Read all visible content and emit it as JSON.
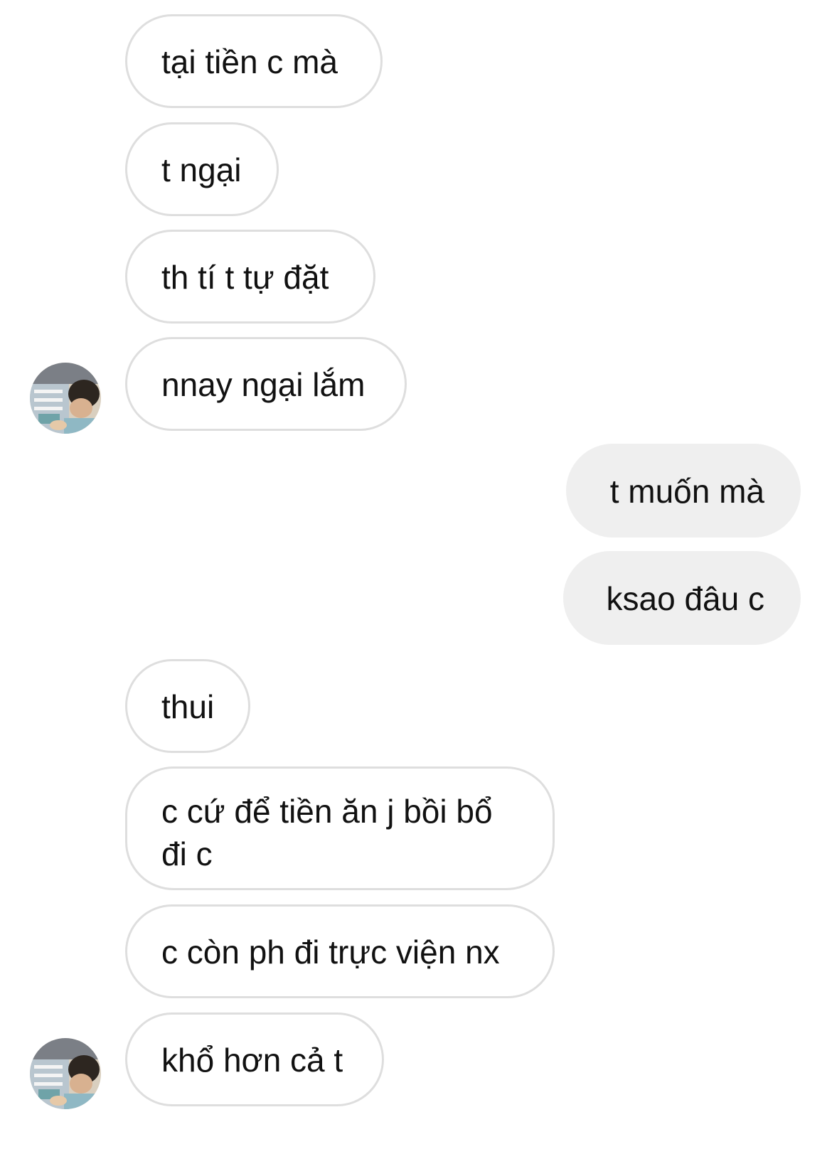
{
  "messages": [
    {
      "id": "m1",
      "from": "them",
      "text": "tại tiền c mà"
    },
    {
      "id": "m2",
      "from": "them",
      "text": "t ngại"
    },
    {
      "id": "m3",
      "from": "them",
      "text": "th tí t tự đặt"
    },
    {
      "id": "m4",
      "from": "them",
      "text": "nnay ngại lắm"
    },
    {
      "id": "m5",
      "from": "me",
      "text": "t muốn mà"
    },
    {
      "id": "m6",
      "from": "me",
      "text": "ksao đâu c"
    },
    {
      "id": "m7",
      "from": "them",
      "text": "thui"
    },
    {
      "id": "m8",
      "from": "them",
      "text": "c cứ để tiền ăn j bồi bổ đi c"
    },
    {
      "id": "m9",
      "from": "them",
      "text": "c còn ph đi trực viện nx"
    },
    {
      "id": "m10",
      "from": "them",
      "text": "khổ hơn cả t"
    }
  ],
  "colors": {
    "incoming_bubble_bg": "#ffffff",
    "incoming_bubble_border": "#dedede",
    "outgoing_bubble_bg": "#efefef",
    "text": "#111111"
  },
  "icons": {
    "avatar": "contact-avatar-photo"
  }
}
